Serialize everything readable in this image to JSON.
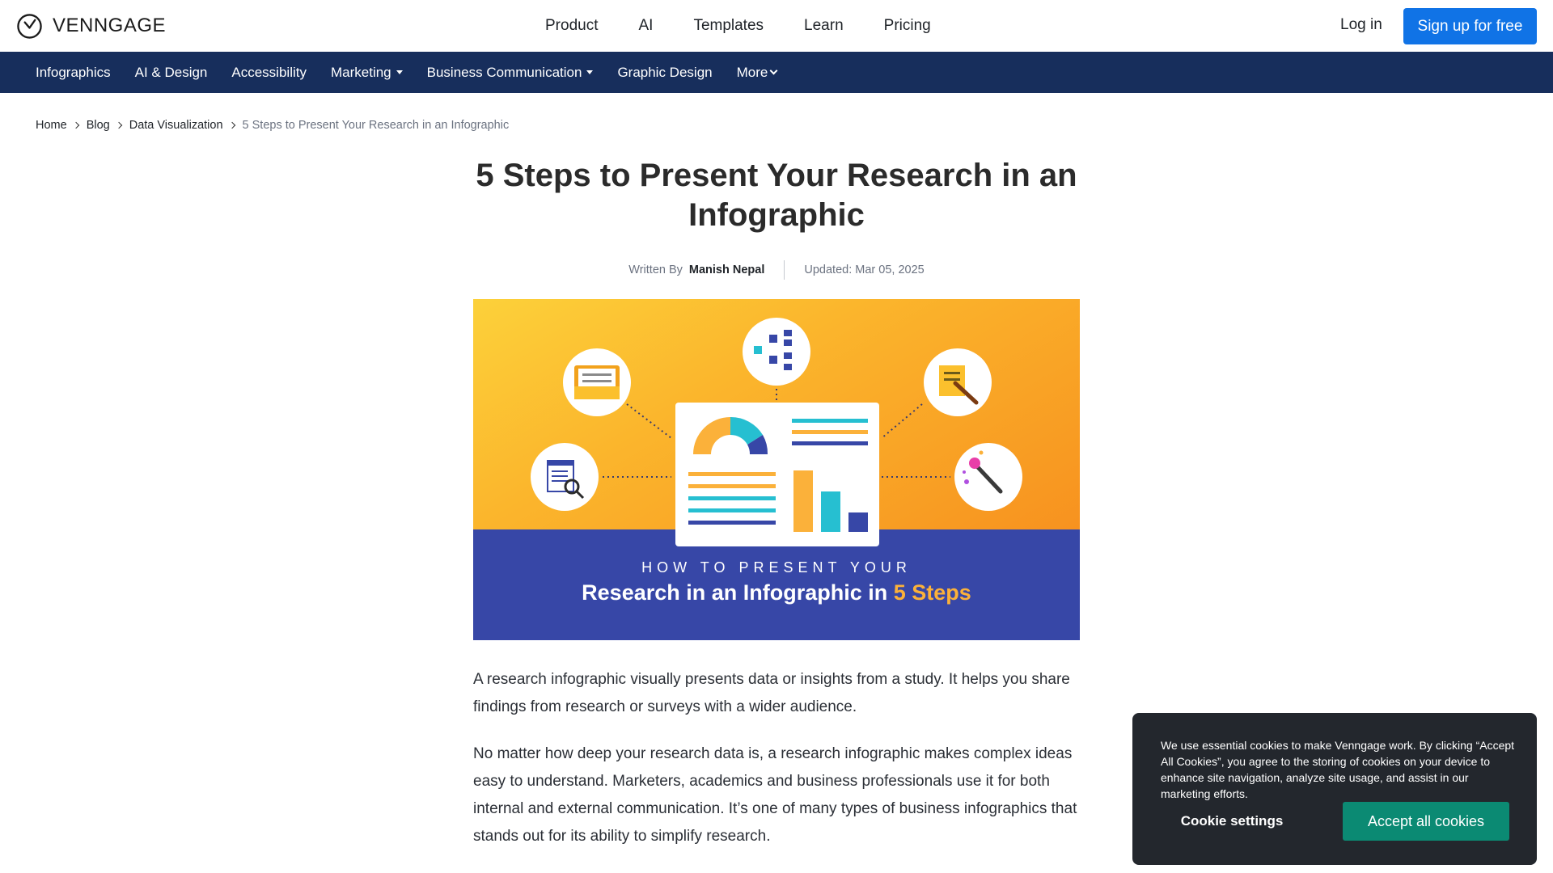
{
  "brand": {
    "name": "VENNGAGE",
    "logo": "venngage-clock-logo"
  },
  "topnav": {
    "items": [
      "Product",
      "AI",
      "Templates",
      "Learn",
      "Pricing"
    ],
    "login": "Log in",
    "signup": "Sign up for free"
  },
  "categories": [
    {
      "label": "Infographics",
      "dropdown": false
    },
    {
      "label": "AI & Design",
      "dropdown": false
    },
    {
      "label": "Accessibility",
      "dropdown": false
    },
    {
      "label": "Marketing",
      "dropdown": true
    },
    {
      "label": "Business Communication",
      "dropdown": true
    },
    {
      "label": "Graphic Design",
      "dropdown": false
    },
    {
      "label": "More",
      "dropdown": true
    }
  ],
  "breadcrumb": {
    "home": "Home",
    "blog": "Blog",
    "section": "Data Visualization",
    "current": "5 Steps to Present Your Research in an Infographic"
  },
  "article": {
    "title": "5 Steps to Present Your Research in an Infographic",
    "written_by_label": "Written By",
    "author": "Manish Nepal",
    "updated": "Updated: Mar 05, 2025",
    "hero": {
      "kicker": "HOW TO PRESENT YOUR",
      "headline": "Research in an Infographic in ",
      "highlight": "5 Steps",
      "icons": [
        "folder-icon",
        "hierarchy-icon",
        "document-edit-icon",
        "report-search-icon",
        "magic-wand-icon"
      ]
    },
    "paragraphs": [
      "A research infographic visually presents data or insights from a study. It helps you share findings from research or surveys with a wider audience.",
      "No matter how deep your research data is, a research infographic makes complex ideas easy to understand. Marketers, academics and business professionals use it for both internal and external communication. It’s one of many types of business infographics that stands out for its ability to simplify research."
    ]
  },
  "cookie": {
    "text": "We use essential cookies to make Venngage work. By clicking “Accept All Cookies”, you agree to the storing of cookies on your device to enhance site navigation, analyze site usage, and assist in our marketing efforts.",
    "settings": "Cookie settings",
    "accept": "Accept all cookies"
  },
  "colors": {
    "primary_blue": "#1073e6",
    "navy_bar": "#172e5c",
    "hero_band": "#3747a7",
    "hero_orange": "#f7921f",
    "cookie_bg": "#23272d",
    "accept_green": "#0b8a73"
  }
}
